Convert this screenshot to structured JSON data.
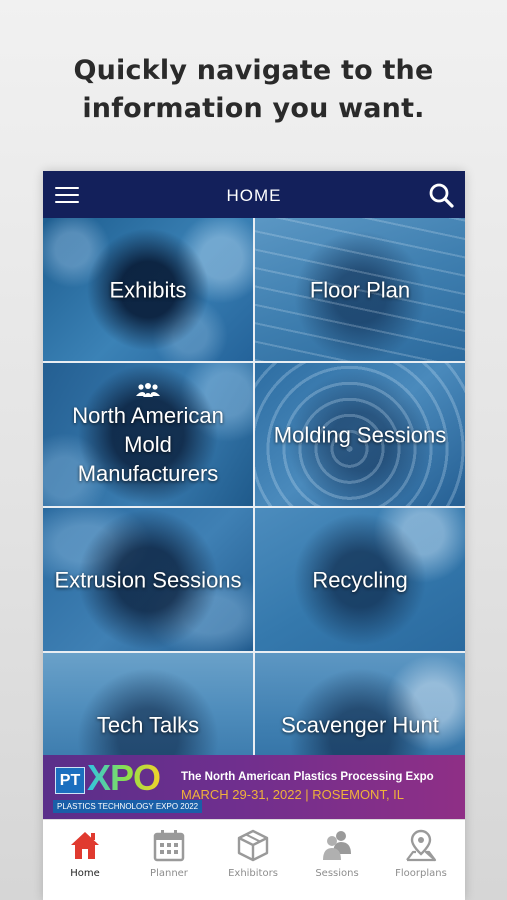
{
  "promo": {
    "line1": "Quickly navigate to the",
    "line2": "information you want."
  },
  "app_bar": {
    "title": "HOME",
    "menu_icon": "hamburger-menu-icon",
    "search_icon": "search-icon"
  },
  "tiles": [
    {
      "label": "Exhibits"
    },
    {
      "label": "Floor Plan"
    },
    {
      "label_lines": [
        "North American",
        "Mold",
        "Manufacturers"
      ],
      "icon": "group-icon"
    },
    {
      "label": "Molding Sessions"
    },
    {
      "label": "Extrusion Sessions"
    },
    {
      "label": "Recycling"
    },
    {
      "label": "Tech Talks"
    },
    {
      "label": "Scavenger Hunt"
    }
  ],
  "banner": {
    "logo_pt": "PT",
    "logo_xpo": "XPO",
    "logo_tagline": "PLASTICS TECHNOLOGY EXPO 2022",
    "headline": "The North American Plastics Processing Expo",
    "dates": "MARCH 29-31, 2022 | ROSEMONT, IL"
  },
  "tab_bar": {
    "tabs": [
      {
        "label": "Home",
        "icon": "home-icon",
        "active": true
      },
      {
        "label": "Planner",
        "icon": "calendar-icon",
        "active": false
      },
      {
        "label": "Exhibitors",
        "icon": "box-icon",
        "active": false
      },
      {
        "label": "Sessions",
        "icon": "people-icon",
        "active": false
      },
      {
        "label": "Floorplans",
        "icon": "map-pin-icon",
        "active": false
      }
    ]
  },
  "colors": {
    "app_bar": "#13205b",
    "tile_blue": "#27679a",
    "active_tab": "#e03a2f",
    "inactive_tab": "#9a9a9a",
    "banner_purple": "#6f2f8e",
    "banner_orange": "#f0b23a"
  }
}
